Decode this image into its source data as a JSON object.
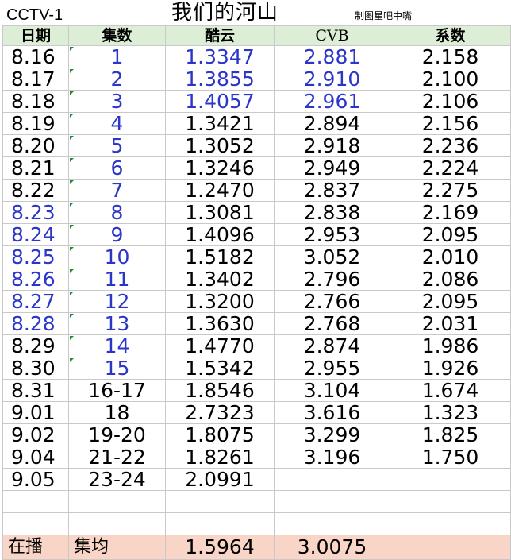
{
  "header": {
    "channel": "CCTV-1",
    "title": "我们的河山",
    "credit": "制图星吧中嘴"
  },
  "table": {
    "columns": [
      "日期",
      "集数",
      "酷云",
      "CVB",
      "系数"
    ],
    "rows": [
      {
        "date": "8.16",
        "episode": "1",
        "kuyun": "1.3347",
        "cvb": "2.881",
        "coef": "2.158"
      },
      {
        "date": "8.17",
        "episode": "2",
        "kuyun": "1.3855",
        "cvb": "2.910",
        "coef": "2.100"
      },
      {
        "date": "8.18",
        "episode": "3",
        "kuyun": "1.4057",
        "cvb": "2.961",
        "coef": "2.106"
      },
      {
        "date": "8.19",
        "episode": "4",
        "kuyun": "1.3421",
        "cvb": "2.894",
        "coef": "2.156"
      },
      {
        "date": "8.20",
        "episode": "5",
        "kuyun": "1.3052",
        "cvb": "2.918",
        "coef": "2.236"
      },
      {
        "date": "8.21",
        "episode": "6",
        "kuyun": "1.3246",
        "cvb": "2.949",
        "coef": "2.224"
      },
      {
        "date": "8.22",
        "episode": "7",
        "kuyun": "1.2470",
        "cvb": "2.837",
        "coef": "2.275"
      },
      {
        "date": "8.23",
        "episode": "8",
        "kuyun": "1.3081",
        "cvb": "2.838",
        "coef": "2.169"
      },
      {
        "date": "8.24",
        "episode": "9",
        "kuyun": "1.4096",
        "cvb": "2.953",
        "coef": "2.095"
      },
      {
        "date": "8.25",
        "episode": "10",
        "kuyun": "1.5182",
        "cvb": "3.052",
        "coef": "2.010"
      },
      {
        "date": "8.26",
        "episode": "11",
        "kuyun": "1.3402",
        "cvb": "2.796",
        "coef": "2.086"
      },
      {
        "date": "8.27",
        "episode": "12",
        "kuyun": "1.3200",
        "cvb": "2.766",
        "coef": "2.095"
      },
      {
        "date": "8.28",
        "episode": "13",
        "kuyun": "1.3630",
        "cvb": "2.768",
        "coef": "2.031"
      },
      {
        "date": "8.29",
        "episode": "14",
        "kuyun": "1.4770",
        "cvb": "2.874",
        "coef": "1.986"
      },
      {
        "date": "8.30",
        "episode": "15",
        "kuyun": "1.5342",
        "cvb": "2.955",
        "coef": "1.926"
      },
      {
        "date": "8.31",
        "episode": "16-17",
        "kuyun": "1.8546",
        "cvb": "3.104",
        "coef": "1.674"
      },
      {
        "date": "9.01",
        "episode": "18",
        "kuyun": "2.7323",
        "cvb": "3.616",
        "coef": "1.323"
      },
      {
        "date": "9.02",
        "episode": "19-20",
        "kuyun": "1.8075",
        "cvb": "3.299",
        "coef": "1.825"
      },
      {
        "date": "9.04",
        "episode": "21-22",
        "kuyun": "1.8261",
        "cvb": "3.196",
        "coef": "1.750"
      },
      {
        "date": "9.05",
        "episode": "23-24",
        "kuyun": "2.0991",
        "cvb": "",
        "coef": ""
      }
    ]
  },
  "footer": {
    "label1": "在播",
    "label2": "集均",
    "avg_kuyun": "1.5964",
    "avg_cvb": "3.0075"
  },
  "colors": {
    "header_bg": "#ddeed6",
    "footer_bg": "#f8d5c7",
    "blue_text": "#2b35c9",
    "gridline": "#c9c9c9"
  }
}
